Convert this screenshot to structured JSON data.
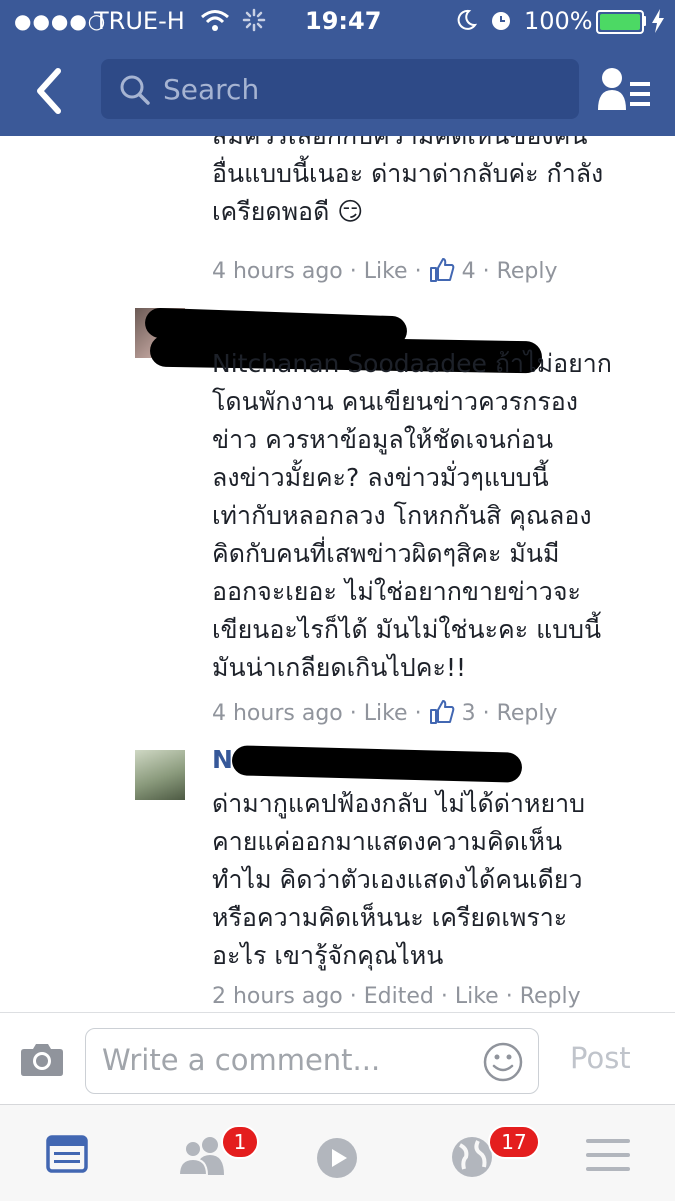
{
  "status": {
    "carrier": "TRUE-H",
    "time": "19:47",
    "battery": "100%"
  },
  "search": {
    "placeholder": "Search"
  },
  "comments": [
    {
      "lines": [
        "สมควรเลือกกับความคิดเห็นของคน",
        "อื่นแบบนี้เนอะ ด่ามาด่ากลับค่ะ กำลัง",
        "เครียดพอดี 😏"
      ],
      "time": "4 hours ago",
      "like_label": "Like",
      "likes": "4",
      "reply_label": "Reply"
    },
    {
      "lines": [
        "Nitchanan Soodaadee ถ้าไม่อยาก",
        "โดนพักงาน คนเขียนข่าวควรกรอง",
        "ข่าว ควรหาข้อมูลให้ชัดเจนก่อน",
        "ลงข่าวมั้ยคะ? ลงข่าวมั่วๆแบบนี้",
        "เท่ากับหลอกลวง โกหกกันสิ คุณลอง",
        "คิดกับคนที่เสพข่าวผิดๆสิคะ มันมี",
        "ออกจะเยอะ ไม่ใช่อยากขายข่าวจะ",
        "เขียนอะไรก็ได้ มันไม่ใช่นะคะ แบบนี้",
        "มันน่าเกลียดเกินไปคะ!!"
      ],
      "time": "4 hours ago",
      "like_label": "Like",
      "likes": "3",
      "reply_label": "Reply"
    },
    {
      "name_initial": "N",
      "lines": [
        "ด่ามากูแคปฟ้องกลับ ไม่ได้ด่าหยาบ",
        "คายแค่ออกมาแสดงความคิดเห็น",
        "ทำไม คิดว่าตัวเองแสดงได้คนเดียว",
        "หรือความคิดเห็นนะ เครียดเพราะ",
        "อะไร เขารู้จักคุณไหน"
      ],
      "time": "2 hours ago",
      "edited_label": "Edited",
      "like_label": "Like",
      "reply_label": "Reply"
    }
  ],
  "composer": {
    "placeholder": "Write a comment...",
    "post_label": "Post"
  },
  "tabbar": {
    "friend_requests_badge": "1",
    "notifications_badge": "17"
  },
  "colors": {
    "brand": "#3b5998",
    "link": "#4267b2",
    "badge": "#e41e1e"
  }
}
